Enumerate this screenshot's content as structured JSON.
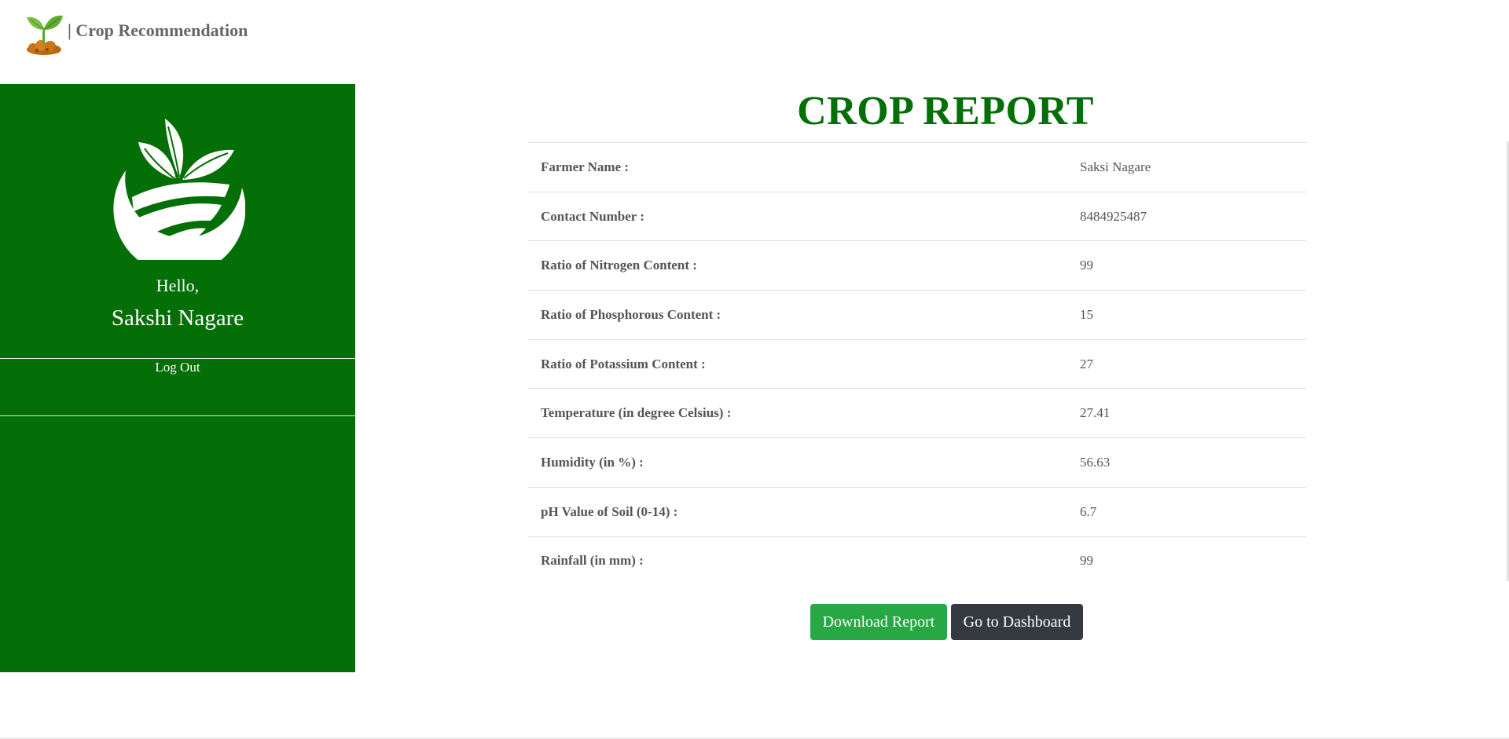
{
  "header": {
    "brand_icon": "sprout-soil-logo-icon",
    "brand_text": "| Crop Recommendation"
  },
  "sidebar": {
    "emblem_icon": "leaf-field-emblem-icon",
    "greeting": "Hello,",
    "user_name": "Sakshi Nagare",
    "logout_label": "Log Out"
  },
  "report": {
    "title": "CROP REPORT",
    "rows": [
      {
        "label": "Farmer Name :",
        "value": "Saksi Nagare"
      },
      {
        "label": "Contact Number :",
        "value": "8484925487"
      },
      {
        "label": "Ratio of Nitrogen Content :",
        "value": "99"
      },
      {
        "label": "Ratio of Phosphorous Content :",
        "value": "15"
      },
      {
        "label": "Ratio of Potassium Content :",
        "value": "27"
      },
      {
        "label": "Temperature (in degree Celsius) :",
        "value": "27.41"
      },
      {
        "label": "Humidity (in %) :",
        "value": "56.63"
      },
      {
        "label": "pH Value of Soil (0-14) :",
        "value": "6.7"
      },
      {
        "label": "Rainfall (in mm) :",
        "value": "99"
      }
    ]
  },
  "actions": {
    "download_label": "Download Report",
    "dashboard_label": "Go to Dashboard"
  },
  "colors": {
    "sidebar_bg": "#046f06",
    "title_green": "#036f07",
    "download_btn": "#28a745",
    "dashboard_btn": "#343a40"
  }
}
